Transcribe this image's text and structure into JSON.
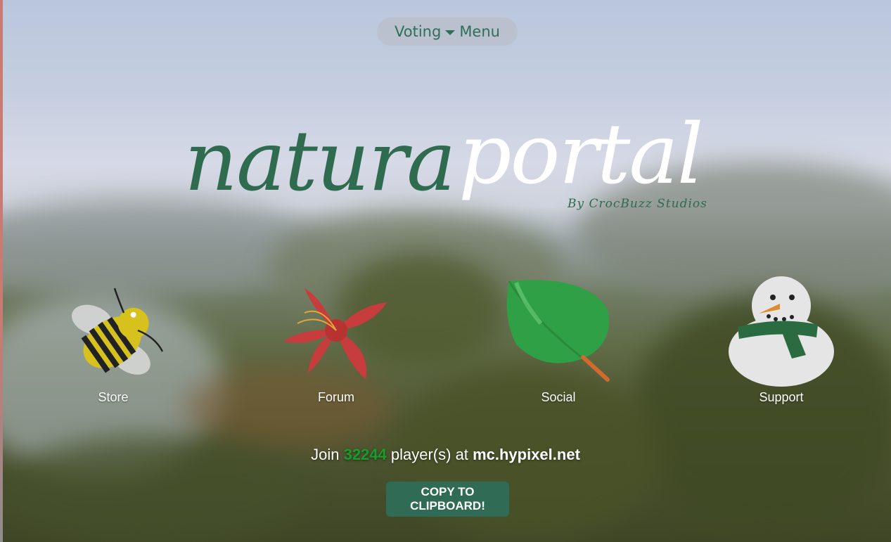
{
  "menu": {
    "voting_label": "Voting",
    "menu_label": "Menu"
  },
  "logo": {
    "part1": "natura",
    "part2": "portal",
    "byline": "By CrocBuzz Studios"
  },
  "nav": [
    {
      "label": "Store",
      "icon": "bee-icon"
    },
    {
      "label": "Forum",
      "icon": "flower-icon"
    },
    {
      "label": "Social",
      "icon": "leaf-icon"
    },
    {
      "label": "Support",
      "icon": "snowman-icon"
    }
  ],
  "join": {
    "prefix": "Join",
    "count": "32244",
    "middle": "player(s) at",
    "address": "mc.hypixel.net"
  },
  "copy_button": {
    "label": "COPY TO\nCLIPBOARD!"
  },
  "colors": {
    "accent_green": "#2f6b4f",
    "count_green": "#1a9c2a",
    "text_white": "#ffffff"
  }
}
